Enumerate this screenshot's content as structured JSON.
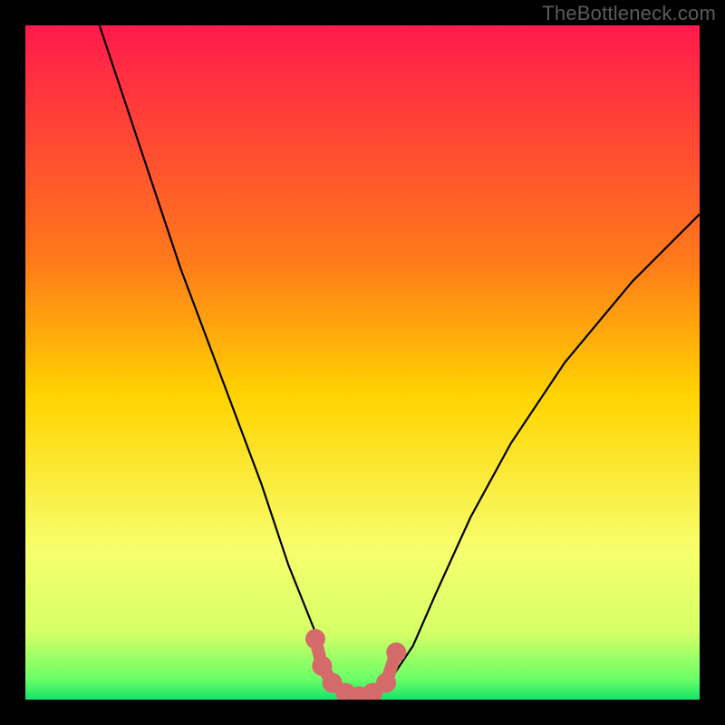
{
  "watermark": "TheBottleneck.com",
  "colors": {
    "background": "#000000",
    "gradient_top": "#ff1a4c",
    "gradient_mid": "#ffd400",
    "gradient_low": "#f7ff6e",
    "gradient_bottom": "#17e36a",
    "curve": "#000000",
    "marker_fill": "#d46a6a",
    "marker_stroke": "#d46a6a"
  },
  "chart_data": {
    "type": "line",
    "title": "",
    "xlabel": "",
    "ylabel": "",
    "xlim": [
      0,
      100
    ],
    "ylim": [
      0,
      100
    ],
    "series": [
      {
        "name": "bottleneck-curve",
        "x_pct": [
          11,
          14,
          17,
          20,
          23,
          26,
          29,
          32,
          35,
          37,
          39,
          41,
          43,
          44.5,
          46,
          48,
          50,
          52,
          54.5,
          57.5,
          61,
          66,
          72,
          80,
          90,
          100
        ],
        "y_pct": [
          100,
          91,
          82,
          73,
          64,
          56,
          48,
          40,
          32,
          26,
          20,
          15,
          10,
          6,
          3,
          1,
          0,
          1,
          3.5,
          8,
          16,
          27,
          38,
          50,
          62,
          72
        ]
      }
    ],
    "markers": {
      "x_pct": [
        43.0,
        44.0,
        45.5,
        47.5,
        49.5,
        51.5,
        53.5,
        55.0
      ],
      "y_pct": [
        9.0,
        5.0,
        2.5,
        1.0,
        0.5,
        1.0,
        2.5,
        7.0
      ]
    },
    "gradient_stops_pct": [
      {
        "offset": 0,
        "color": "#ff1a4c"
      },
      {
        "offset": 35,
        "color": "#ff7a1a"
      },
      {
        "offset": 55,
        "color": "#ffd400"
      },
      {
        "offset": 78,
        "color": "#f7ff6e"
      },
      {
        "offset": 90,
        "color": "#d6ff66"
      },
      {
        "offset": 97,
        "color": "#6aff66"
      },
      {
        "offset": 100,
        "color": "#17e36a"
      }
    ]
  }
}
